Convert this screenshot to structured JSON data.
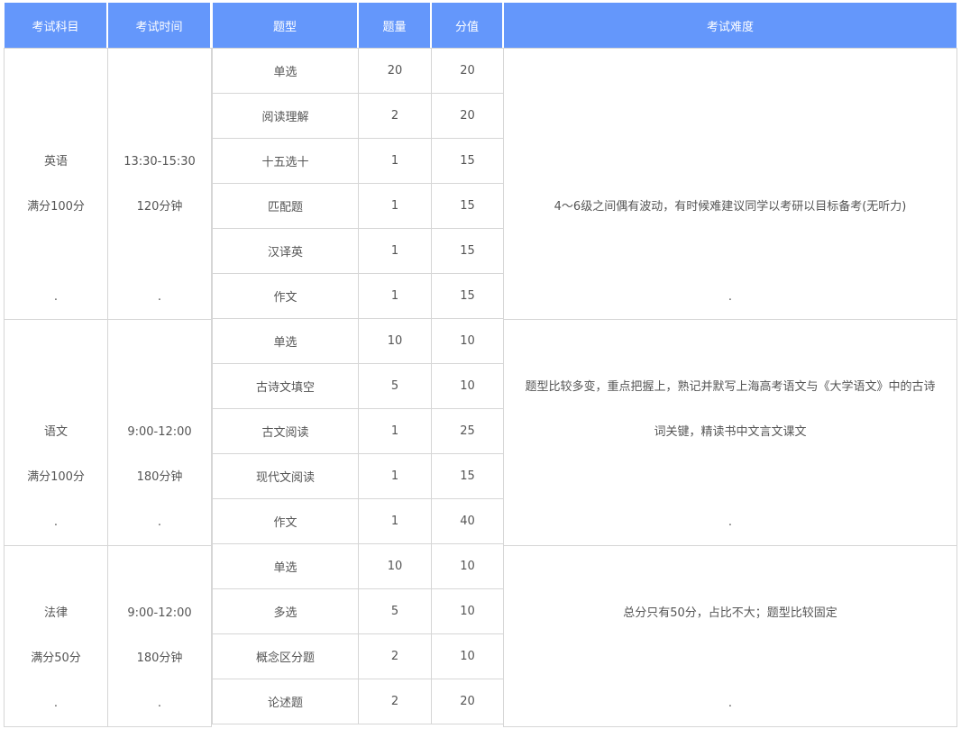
{
  "header": {
    "subject": "考试科目",
    "time": "考试时间",
    "type": "题型",
    "count": "题量",
    "score": "分值",
    "difficulty": "考试难度"
  },
  "groups": [
    {
      "subject": "英语",
      "full": "满分100分",
      "time": "13:30-15:30",
      "duration": "120分钟",
      "dot": ".",
      "difficulty_lines": [
        "4～6级之间偶有波动，有时候难建议同学以考研以目标备考(无听力)"
      ],
      "rows": [
        {
          "type": "单选",
          "count": "20",
          "score": "20"
        },
        {
          "type": "阅读理解",
          "count": "2",
          "score": "20"
        },
        {
          "type": "十五选十",
          "count": "1",
          "score": "15"
        },
        {
          "type": "匹配题",
          "count": "1",
          "score": "15"
        },
        {
          "type": "汉译英",
          "count": "1",
          "score": "15"
        },
        {
          "type": "作文",
          "count": "1",
          "score": "15"
        }
      ]
    },
    {
      "subject": "语文",
      "full": "满分100分",
      "time": "9:00-12:00",
      "duration": "180分钟",
      "dot": ".",
      "difficulty_lines": [
        "题型比较多变，重点把握上，熟记并默写上海高考语文与《大学语文》中的古诗",
        "词关键，精读书中文言文课文"
      ],
      "rows": [
        {
          "type": "单选",
          "count": "10",
          "score": "10"
        },
        {
          "type": "古诗文填空",
          "count": "5",
          "score": "10"
        },
        {
          "type": "古文阅读",
          "count": "1",
          "score": "25"
        },
        {
          "type": "现代文阅读",
          "count": "1",
          "score": "15"
        },
        {
          "type": "作文",
          "count": "1",
          "score": "40"
        }
      ]
    },
    {
      "subject": "法律",
      "full": "满分50分",
      "time": "9:00-12:00",
      "duration": "180分钟",
      "dot": ".",
      "difficulty_lines": [
        "总分只有50分，占比不大；题型比较固定"
      ],
      "rows": [
        {
          "type": "单选",
          "count": "10",
          "score": "10"
        },
        {
          "type": "多选",
          "count": "5",
          "score": "10"
        },
        {
          "type": "概念区分题",
          "count": "2",
          "score": "10"
        },
        {
          "type": "论述题",
          "count": "2",
          "score": "20"
        }
      ]
    }
  ]
}
